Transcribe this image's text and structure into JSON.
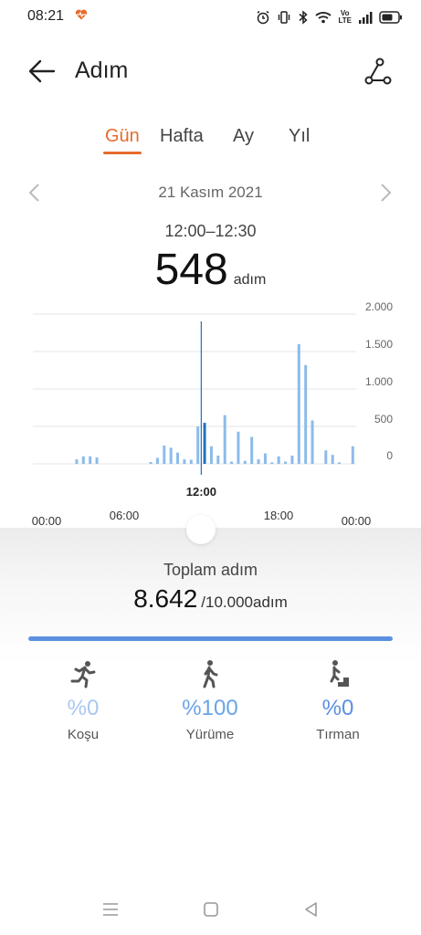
{
  "status": {
    "time": "08:21",
    "volte_line1": "Vo",
    "volte_line2": "LTE"
  },
  "header": {
    "title": "Adım"
  },
  "tabs": [
    {
      "label": "Gün",
      "active": true
    },
    {
      "label": "Hafta",
      "active": false
    },
    {
      "label": "Ay",
      "active": false
    },
    {
      "label": "Yıl",
      "active": false
    }
  ],
  "date": {
    "label": "21 Kasım 2021"
  },
  "selection": {
    "range": "12:00–12:30",
    "value": "548",
    "unit": "adım"
  },
  "colors": {
    "accent": "#e86a2c",
    "bar": "#8cbbe9",
    "bar_selected": "#1f73c4",
    "progress": "#5b8fe0",
    "pct_text": "#6aa4e6"
  },
  "chart_data": {
    "type": "bar",
    "ylim": [
      0,
      2000
    ],
    "yticks": [
      "2.000",
      "1.500",
      "1.000",
      "500",
      "0"
    ],
    "ytick_values": [
      2000,
      1500,
      1000,
      500,
      0
    ],
    "xticks": [
      "00:00",
      "06:00",
      "12:00",
      "18:00",
      "00:00"
    ],
    "selected_label": "12:00",
    "grid": true,
    "bin_minutes": 30,
    "bins": [
      {
        "t": "03:00",
        "v": 60
      },
      {
        "t": "03:30",
        "v": 100
      },
      {
        "t": "04:00",
        "v": 100
      },
      {
        "t": "04:30",
        "v": 85
      },
      {
        "t": "08:30",
        "v": 25
      },
      {
        "t": "09:00",
        "v": 80
      },
      {
        "t": "09:30",
        "v": 245
      },
      {
        "t": "10:00",
        "v": 215
      },
      {
        "t": "10:30",
        "v": 150
      },
      {
        "t": "11:00",
        "v": 60
      },
      {
        "t": "11:30",
        "v": 55
      },
      {
        "t": "12:00",
        "v": 500
      },
      {
        "t": "12:30",
        "v": 548
      },
      {
        "t": "13:00",
        "v": 235
      },
      {
        "t": "13:30",
        "v": 110
      },
      {
        "t": "14:00",
        "v": 650
      },
      {
        "t": "14:30",
        "v": 30
      },
      {
        "t": "15:00",
        "v": 430
      },
      {
        "t": "15:30",
        "v": 40
      },
      {
        "t": "16:00",
        "v": 360
      },
      {
        "t": "16:30",
        "v": 60
      },
      {
        "t": "17:00",
        "v": 140
      },
      {
        "t": "17:30",
        "v": 20
      },
      {
        "t": "18:00",
        "v": 100
      },
      {
        "t": "18:30",
        "v": 30
      },
      {
        "t": "19:00",
        "v": 110
      },
      {
        "t": "19:30",
        "v": 1600
      },
      {
        "t": "20:00",
        "v": 1320
      },
      {
        "t": "20:30",
        "v": 580
      },
      {
        "t": "21:30",
        "v": 180
      },
      {
        "t": "22:00",
        "v": 120
      },
      {
        "t": "22:30",
        "v": 20
      },
      {
        "t": "23:30",
        "v": 235
      }
    ],
    "selected_bin": "12:30"
  },
  "summary": {
    "label": "Toplam adım",
    "total": "8.642",
    "goal": "/10.000adım",
    "progress": 1.0
  },
  "activities": [
    {
      "icon": "running-icon",
      "pct": "%0",
      "name": "Koşu"
    },
    {
      "icon": "walking-icon",
      "pct": "%100",
      "name": "Yürüme"
    },
    {
      "icon": "climbing-icon",
      "pct": "%0",
      "name": "Tırman"
    }
  ]
}
